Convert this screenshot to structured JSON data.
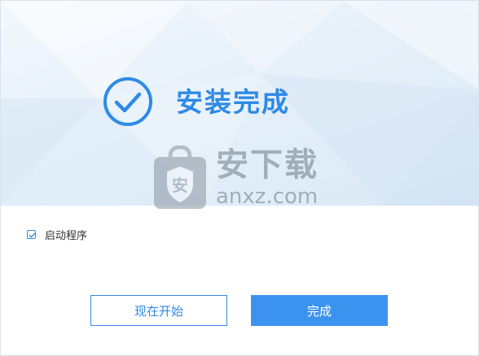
{
  "window": {
    "title": "安装完成"
  },
  "watermark": {
    "logo_char": "安",
    "text": "安下载",
    "domain": "anxz.com"
  },
  "options": {
    "launch_label": "启动程序",
    "launch_checked": true
  },
  "buttons": {
    "start_now": "现在开始",
    "finish": "完成"
  },
  "colors": {
    "accent": "#2f8ae6",
    "primary_button": "#3c93ef",
    "banner_bg": "#e6f0f9"
  },
  "icons": {
    "success": "check-circle-icon",
    "checkbox": "checkmark-icon"
  }
}
